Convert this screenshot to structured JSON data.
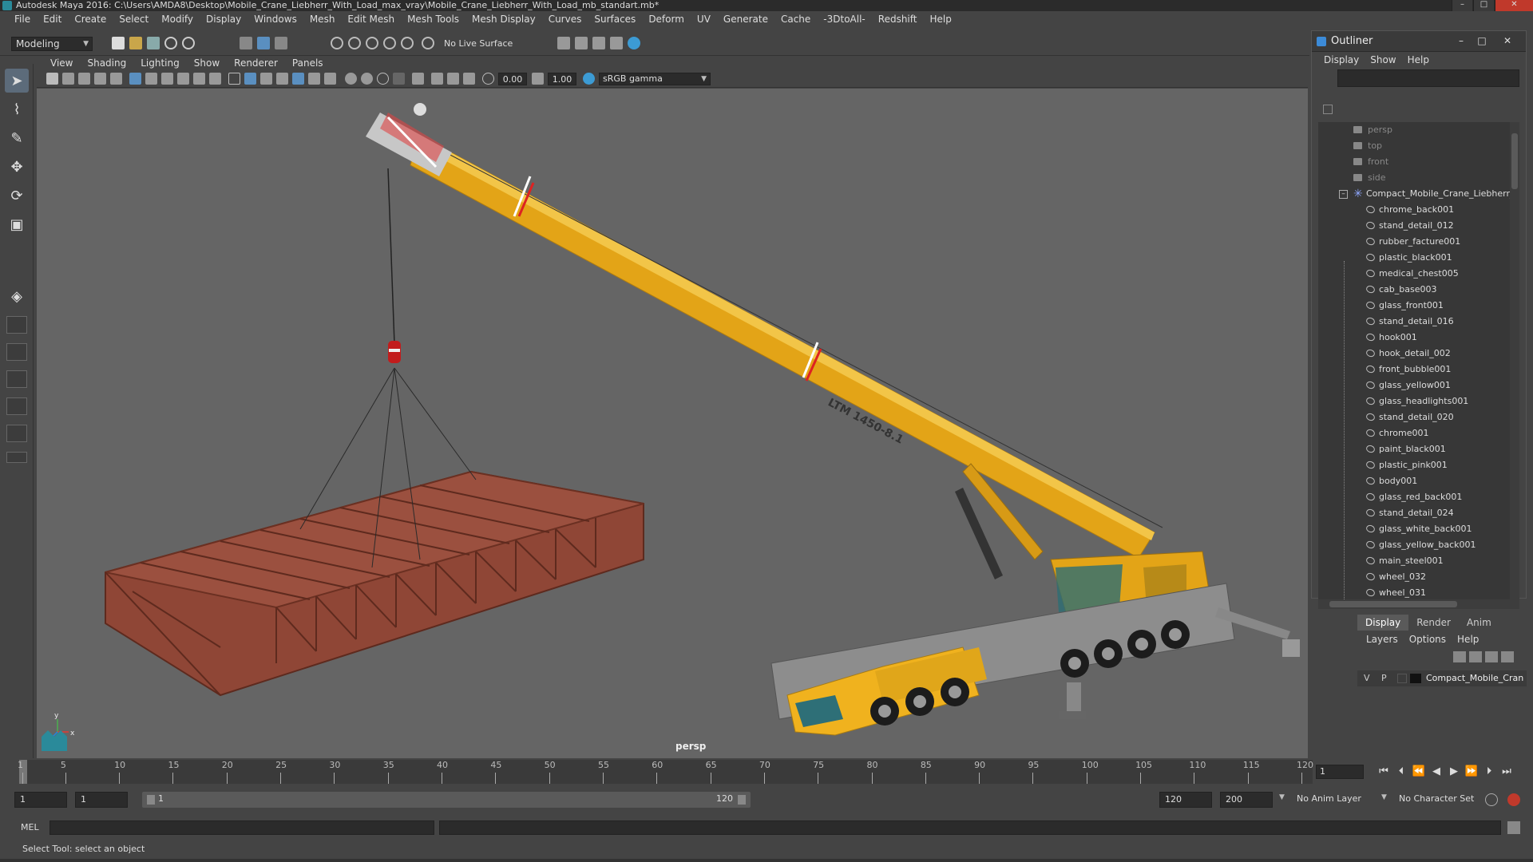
{
  "window": {
    "title": "Autodesk Maya 2016: C:\\Users\\AMDA8\\Desktop\\Mobile_Crane_Liebherr_With_Load_max_vray\\Mobile_Crane_Liebherr_With_Load_mb_standart.mb*"
  },
  "menubar": [
    "File",
    "Edit",
    "Create",
    "Select",
    "Modify",
    "Display",
    "Windows",
    "Mesh",
    "Edit Mesh",
    "Mesh Tools",
    "Mesh Display",
    "Curves",
    "Surfaces",
    "Deform",
    "UV",
    "Generate",
    "Cache",
    "-3DtoAll-",
    "Redshift",
    "Help"
  ],
  "shelf": {
    "mode": "Modeling",
    "live_surface": "No Live Surface"
  },
  "panel_menu": [
    "View",
    "Shading",
    "Lighting",
    "Show",
    "Renderer",
    "Panels"
  ],
  "panel_fields": {
    "exposure": "0.00",
    "gamma_value": "1.00",
    "color_space": "sRGB gamma"
  },
  "viewport": {
    "camera": "persp",
    "crane_label": "LTM 1450-8.1",
    "axis_y": "y",
    "axis_x": "x"
  },
  "outliner": {
    "title": "Outliner",
    "menu": [
      "Display",
      "Show",
      "Help"
    ],
    "cameras": [
      "persp",
      "top",
      "front",
      "side"
    ],
    "root": "Compact_Mobile_Crane_Liebherr_W",
    "children": [
      "chrome_back001",
      "stand_detail_012",
      "rubber_facture001",
      "plastic_black001",
      "medical_chest005",
      "cab_base003",
      "glass_front001",
      "stand_detail_016",
      "hook001",
      "hook_detail_002",
      "front_bubble001",
      "glass_yellow001",
      "glass_headlights001",
      "stand_detail_020",
      "chrome001",
      "paint_black001",
      "plastic_pink001",
      "body001",
      "glass_red_back001",
      "stand_detail_024",
      "glass_white_back001",
      "glass_yellow_back001",
      "main_steel001",
      "wheel_032",
      "wheel_031"
    ]
  },
  "layers": {
    "tabs": [
      "Display",
      "Render",
      "Anim"
    ],
    "menu": [
      "Layers",
      "Options",
      "Help"
    ],
    "row": {
      "v": "V",
      "p": "P",
      "name": "Compact_Mobile_Cran"
    }
  },
  "timeline": {
    "ticks": [
      "1",
      "5",
      "10",
      "15",
      "20",
      "25",
      "30",
      "35",
      "40",
      "45",
      "50",
      "55",
      "60",
      "65",
      "70",
      "75",
      "80",
      "85",
      "90",
      "95",
      "100",
      "105",
      "110",
      "115",
      "120"
    ],
    "current_frame": "1"
  },
  "range": {
    "start": "1",
    "playback_start": "1",
    "slider_start": "1",
    "slider_end": "120",
    "playback_end": "120",
    "end": "200",
    "anim_layer": "No Anim Layer",
    "character_set": "No Character Set"
  },
  "command": {
    "lang": "MEL"
  },
  "help_line": "Select Tool: select an object"
}
